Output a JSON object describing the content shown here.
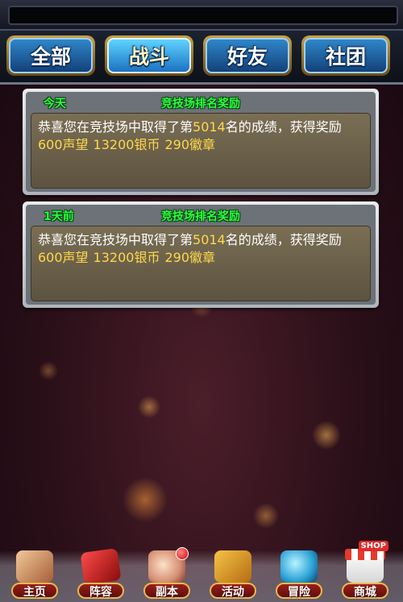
{
  "tabs": [
    {
      "label": "全部",
      "active": false
    },
    {
      "label": "战斗",
      "active": true
    },
    {
      "label": "好友",
      "active": false
    },
    {
      "label": "社团",
      "active": false
    }
  ],
  "messages": [
    {
      "time": "今天",
      "title": "竞技场排名奖励",
      "text_before": "恭喜您在竞技场中取得了第",
      "rank": "5014",
      "text_after": "名的成绩，获得奖励",
      "rewards": [
        "600声望",
        "13200银币",
        "290徽章"
      ]
    },
    {
      "time": "1天前",
      "title": "竞技场排名奖励",
      "text_before": "恭喜您在竞技场中取得了第",
      "rank": "5014",
      "text_after": "名的成绩，获得奖励",
      "rewards": [
        "600声望",
        "13200银币",
        "290徽章"
      ]
    }
  ],
  "bottom_nav": [
    {
      "label": "主页",
      "icon": "home-building-icon"
    },
    {
      "label": "阵容",
      "icon": "lineup-cards-icon"
    },
    {
      "label": "副本",
      "icon": "dungeon-fist-icon"
    },
    {
      "label": "活动",
      "icon": "activity-horn-icon"
    },
    {
      "label": "冒险",
      "icon": "adventure-globe-icon"
    },
    {
      "label": "商城",
      "icon": "shop-store-icon",
      "icon_text": "SHOP"
    }
  ],
  "colors": {
    "card_highlight": "#2bff40",
    "number_highlight": "#ffd84a",
    "tab_blue": "#2f86c9"
  }
}
